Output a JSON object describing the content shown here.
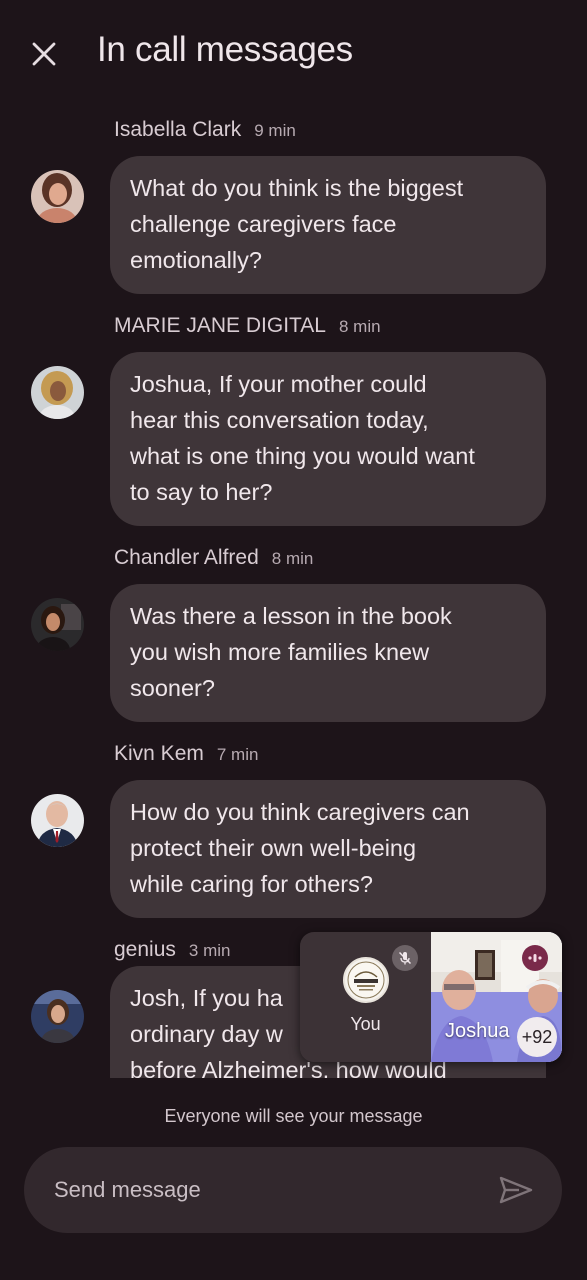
{
  "header": {
    "title": "In call messages",
    "close_icon": "close-icon"
  },
  "messages": [
    {
      "sender": "Isabella Clark",
      "time": "9 min",
      "lines": [
        "What do you think is the biggest",
        "challenge caregivers face",
        "emotionally?"
      ]
    },
    {
      "sender": "MARIE JANE DIGITAL",
      "time": "8 min",
      "lines": [
        "Joshua, If your mother could",
        "hear this conversation today,",
        "what is one thing you would want",
        "to say to her?"
      ]
    },
    {
      "sender": "Chandler Alfred",
      "time": "8 min",
      "lines": [
        "Was there a lesson in the book",
        "you wish more families knew",
        "sooner?"
      ]
    },
    {
      "sender": "Kivn Kem",
      "time": "7 min",
      "lines": [
        "How do you think caregivers can",
        "protect their own well-being",
        "while caring for others?"
      ]
    },
    {
      "sender": "genius",
      "time": "3 min",
      "lines": [
        "Josh, If you ha",
        "ordinary day w",
        "before Alzheimer's, how would"
      ]
    }
  ],
  "notice": "Everyone will see your message",
  "composer": {
    "placeholder": "Send message",
    "send_icon": "send-icon"
  },
  "pip": {
    "self_label": "You",
    "remote_label": "Joshua",
    "participant_count": "+92",
    "mic_icon": "mic-off-icon",
    "speaking_icon": "speaking-indicator-icon"
  },
  "colors": {
    "background": "#1d1419",
    "bubble": "#3f3539",
    "composer": "#32282d"
  }
}
